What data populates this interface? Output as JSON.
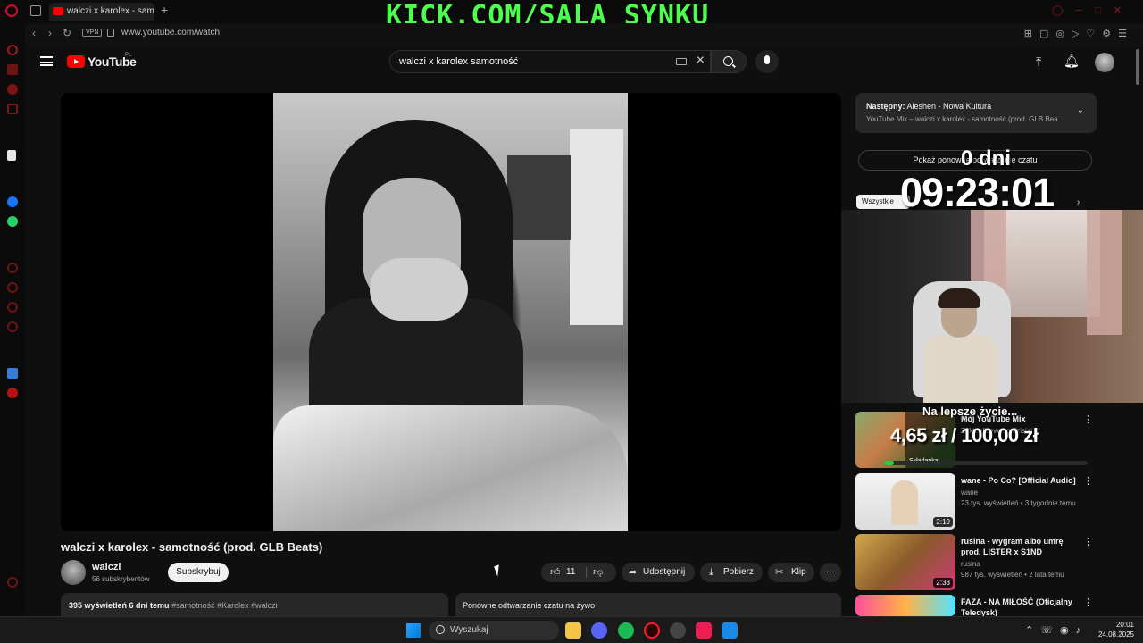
{
  "browser": {
    "tab_title": "walczi x karolex - sam",
    "new_tab_label": "+",
    "stream_banner": "KICK.COM/SALA_SYNKU",
    "vpn_label": "VPN",
    "url": "www.youtube.com/watch"
  },
  "youtube": {
    "logo_text": "YouTube",
    "region": "PL",
    "search_value": "walczi x karolex samotność"
  },
  "video": {
    "title": "walczi x karolex - samotność (prod. GLB Beats)",
    "channel_name": "walczi",
    "subscriber_count": "56 subskrybentów",
    "subscribe_label": "Subskrybuj",
    "like_count": "11",
    "share_label": "Udostępnij",
    "download_label": "Pobierz",
    "clip_label": "Klip",
    "more_label": "···",
    "views": "395 wyświetleń  6 dni temu",
    "tags": "#samotność #Karolex #walczi",
    "chat_replay_header": "Ponowne odtwarzanie czatu na żywo"
  },
  "sidepanel": {
    "next_prefix": "Następny:",
    "next_title": "Aleshen - Nowa Kultura",
    "next_subtitle": "YouTube Mix – walczi x karolex - samotność (prod. GLB Bea...",
    "replay_button": "Pokaż ponowne odtwarzanie czatu",
    "filter_chip": "Wszystkie"
  },
  "overlay": {
    "countdown_days": "0 dni",
    "countdown_time": "09:23:01",
    "goal_title": "Na lepsze życie...",
    "goal_amount": "4,65 zł / 100,00 zł",
    "goal_progress": 0.0465,
    "goal_color": "#2ecc40"
  },
  "recommendations": [
    {
      "title": "Mój YouTube Mix",
      "channel": "Zaktualizowano dzisiaj",
      "meta": "",
      "badge": "Składanka",
      "duration": ""
    },
    {
      "title": "wane - Po Co? [Official Audio]",
      "channel": "wane",
      "meta": "23 tys. wyświetleń • 3 tygodnie temu",
      "duration": "2:19"
    },
    {
      "title": "rusina - wygram albo umrę prod. LISTER x S1ND",
      "channel": "rusina",
      "meta": "987 tys. wyświetleń • 2 lata temu",
      "duration": "2:33"
    },
    {
      "title": "FAZA - NA MIŁOŚĆ (Oficjalny Teledysk)",
      "channel": "",
      "meta": "",
      "duration": ""
    }
  ],
  "taskbar": {
    "search_label": "Wyszukaj",
    "time": "20:01",
    "date": "24.08.2025"
  },
  "colors": {
    "banner_green": "#4cff4c",
    "youtube_red": "#ff0000",
    "background": "#0f0f0f"
  }
}
